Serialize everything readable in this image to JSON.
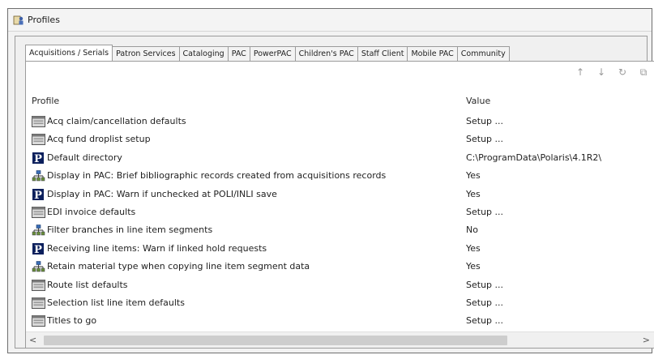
{
  "window": {
    "title": "Profiles"
  },
  "tabs": [
    {
      "label": "Acquisitions / Serials",
      "active": true
    },
    {
      "label": "Patron Services",
      "active": false
    },
    {
      "label": "Cataloging",
      "active": false
    },
    {
      "label": "PAC",
      "active": false
    },
    {
      "label": "PowerPAC",
      "active": false
    },
    {
      "label": "Children's PAC",
      "active": false
    },
    {
      "label": "Staff Client",
      "active": false
    },
    {
      "label": "Mobile PAC",
      "active": false
    },
    {
      "label": "Community",
      "active": false
    }
  ],
  "toolbar": {
    "up_icon": "↑",
    "down_icon": "↓",
    "refresh_icon": "↻",
    "copy_icon": "⧉"
  },
  "grid": {
    "headers": {
      "profile": "Profile",
      "value": "Value"
    },
    "rows": [
      {
        "icon": "setup-dialog-icon",
        "label": "Acq claim/cancellation defaults",
        "value": "Setup ..."
      },
      {
        "icon": "setup-dialog-icon",
        "label": "Acq fund droplist setup",
        "value": "Setup ..."
      },
      {
        "icon": "polaris-p-icon",
        "label": "Default directory",
        "value": "C:\\ProgramData\\Polaris\\4.1R2\\"
      },
      {
        "icon": "org-tree-icon",
        "label": "Display in PAC: Brief bibliographic records created from acquisitions records",
        "value": "Yes"
      },
      {
        "icon": "polaris-p-icon",
        "label": "Display in PAC: Warn if unchecked at POLI/INLI save",
        "value": "Yes"
      },
      {
        "icon": "setup-dialog-icon",
        "label": "EDI invoice defaults",
        "value": "Setup ..."
      },
      {
        "icon": "org-tree-icon",
        "label": "Filter branches in line item segments",
        "value": "No"
      },
      {
        "icon": "polaris-p-icon",
        "label": "Receiving line items: Warn if linked hold requests",
        "value": "Yes"
      },
      {
        "icon": "org-tree-icon",
        "label": "Retain material type when copying line item segment data",
        "value": "Yes"
      },
      {
        "icon": "setup-dialog-icon",
        "label": "Route list defaults",
        "value": "Setup ..."
      },
      {
        "icon": "setup-dialog-icon",
        "label": "Selection list line item defaults",
        "value": "Setup ..."
      },
      {
        "icon": "setup-dialog-icon",
        "label": "Titles to go",
        "value": "Setup ..."
      }
    ]
  },
  "scrollbar": {
    "left_arrow": "<",
    "right_arrow": ">"
  }
}
